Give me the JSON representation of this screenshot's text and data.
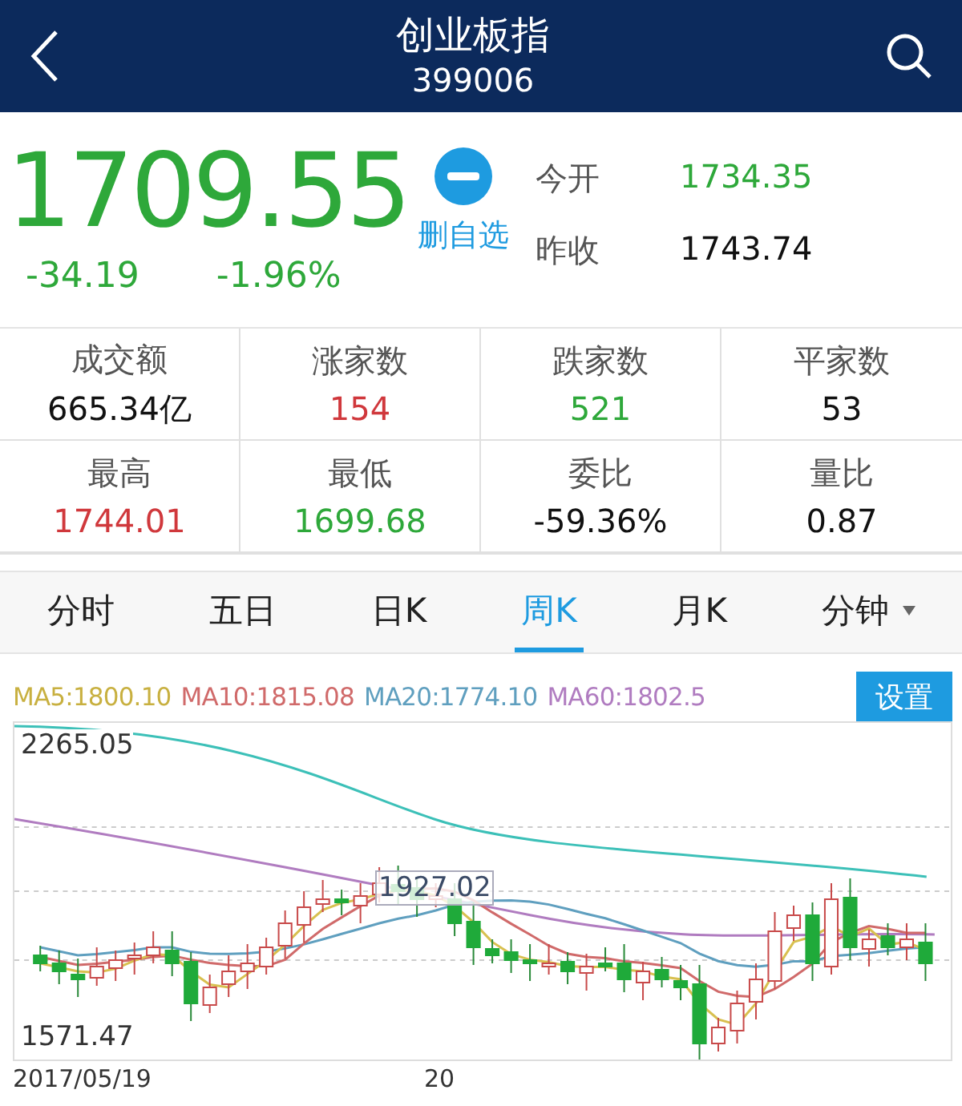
{
  "header": {
    "title": "创业板指",
    "code": "399006"
  },
  "quote": {
    "price": "1709.55",
    "change": "-34.19",
    "change_pct": "-1.96%",
    "watchlist_action": "删自选",
    "color": "#2ea83a"
  },
  "side_stats": [
    {
      "label": "今开",
      "value": "1734.35",
      "color": "#2ea83a"
    },
    {
      "label": "昨收",
      "value": "1743.74",
      "color": "#111111"
    }
  ],
  "stats": [
    {
      "label": "成交额",
      "value": "665.34亿",
      "color": "#111111"
    },
    {
      "label": "涨家数",
      "value": "154",
      "color": "#d0383c"
    },
    {
      "label": "跌家数",
      "value": "521",
      "color": "#2ea83a"
    },
    {
      "label": "平家数",
      "value": "53",
      "color": "#111111"
    },
    {
      "label": "最高",
      "value": "1744.01",
      "color": "#d0383c"
    },
    {
      "label": "最低",
      "value": "1699.68",
      "color": "#2ea83a"
    },
    {
      "label": "委比",
      "value": "-59.36%",
      "color": "#111111"
    },
    {
      "label": "量比",
      "value": "0.87",
      "color": "#111111"
    }
  ],
  "tabs": [
    {
      "label": "分时",
      "selected": false,
      "dropdown": false
    },
    {
      "label": "五日",
      "selected": false,
      "dropdown": false
    },
    {
      "label": "日K",
      "selected": false,
      "dropdown": false
    },
    {
      "label": "周K",
      "selected": true,
      "dropdown": false
    },
    {
      "label": "月K",
      "selected": false,
      "dropdown": false
    },
    {
      "label": "分钟",
      "selected": false,
      "dropdown": true
    }
  ],
  "chart": {
    "legend": [
      {
        "text": "MA5:1800.10",
        "color": "#c8b040"
      },
      {
        "text": "MA10:1815.08",
        "color": "#d06a6a"
      },
      {
        "text": "MA20:1774.10",
        "color": "#5f9fbf"
      },
      {
        "text": "MA60:1802.5",
        "color": "#b07cc0"
      }
    ],
    "settings_button": "设置",
    "max_label": "2265.05",
    "min_label": "1571.47",
    "high_marker": "1927.02",
    "dates": [
      "2017/05/19",
      "20"
    ]
  }
}
